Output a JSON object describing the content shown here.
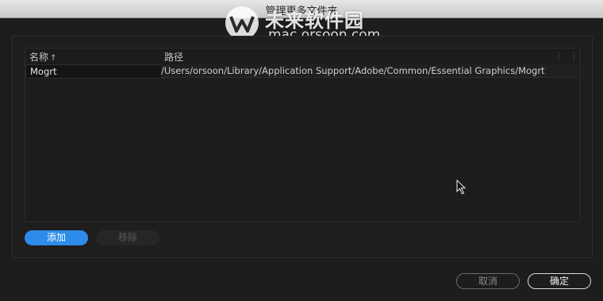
{
  "window": {
    "title": "管理更多文件夹"
  },
  "watermark": {
    "name": "未来软件园",
    "url": "mac.orsoon.com"
  },
  "table": {
    "columns": [
      "名称",
      "路径"
    ],
    "sort_arrow": "↑",
    "rows": [
      {
        "name": "Mogrt",
        "path": "/Users/orsoon/Library/Application Support/Adobe/Common/Essential Graphics/Mogrt"
      }
    ]
  },
  "buttons": {
    "add": "添加",
    "remove": "移除",
    "cancel": "取消",
    "ok": "确定"
  },
  "colors": {
    "accent": "#2d8ceb",
    "background": "#1d1d1d"
  },
  "icons": {
    "cursor": "mouse-pointer-icon",
    "logo": "orsoon-logo-icon"
  }
}
